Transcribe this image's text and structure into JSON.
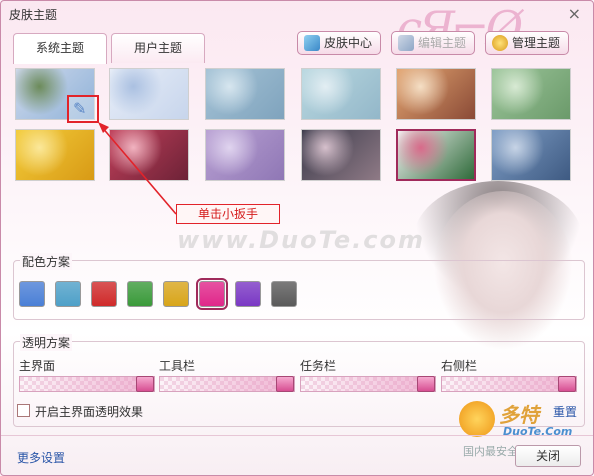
{
  "window": {
    "title": "皮肤主题",
    "close_glyph": "×"
  },
  "tabs": [
    {
      "label": "系统主题",
      "active": true
    },
    {
      "label": "用户主题",
      "active": false
    }
  ],
  "toolbar": {
    "skin_center": "皮肤中心",
    "edit_theme": "编辑主题",
    "manage_theme": "管理主题"
  },
  "themes": [
    {
      "name": "theme-lake",
      "colors": [
        "#cfd9ec",
        "#8fb2d8",
        "#6c8b5a"
      ]
    },
    {
      "name": "theme-light-blue",
      "colors": [
        "#e8eef8",
        "#c7d5ec",
        "#aac0e1"
      ]
    },
    {
      "name": "theme-bokeh-blue",
      "colors": [
        "#a5c3d6",
        "#7fa3bd",
        "#d7e6ef"
      ]
    },
    {
      "name": "theme-teal-haze",
      "colors": [
        "#b9d8e0",
        "#93b7c9",
        "#e3eef3"
      ]
    },
    {
      "name": "theme-swirl",
      "colors": [
        "#e3a571",
        "#8a4a36",
        "#f5dfc5"
      ]
    },
    {
      "name": "theme-bamboo",
      "colors": [
        "#9cc59a",
        "#6b9a6a",
        "#d8ead4"
      ]
    },
    {
      "name": "theme-sunflower",
      "colors": [
        "#f3cc3a",
        "#d89a15",
        "#fbe89a"
      ]
    },
    {
      "name": "theme-red-bokeh",
      "colors": [
        "#c0405a",
        "#6d2237",
        "#f1b3c0"
      ]
    },
    {
      "name": "theme-lilac",
      "colors": [
        "#b9a1d3",
        "#8f77b5",
        "#e0d4ef"
      ]
    },
    {
      "name": "theme-light-streak",
      "colors": [
        "#3a3a4a",
        "#8f7a86",
        "#d6c0cc"
      ]
    },
    {
      "name": "theme-drama",
      "colors": [
        "#f4f4f4",
        "#2f6b3a",
        "#d86a8a"
      ],
      "selected": true
    },
    {
      "name": "theme-city-night",
      "colors": [
        "#7f9ec6",
        "#3e5a82",
        "#c7d4e6"
      ]
    }
  ],
  "callout": "单击小扳手",
  "watermark": "www.DuoTe.com",
  "color_scheme": {
    "label": "配色方案",
    "swatches": [
      {
        "name": "blue",
        "color": "#4a7fd6"
      },
      {
        "name": "teal",
        "color": "#4ea0c8"
      },
      {
        "name": "red",
        "color": "#cf2a2a"
      },
      {
        "name": "green",
        "color": "#3a9a3a"
      },
      {
        "name": "gold",
        "color": "#d8a51a"
      },
      {
        "name": "pink",
        "color": "#e0278a",
        "selected": true
      },
      {
        "name": "purple",
        "color": "#7a38c4"
      },
      {
        "name": "gray",
        "color": "#5a5a5a"
      }
    ]
  },
  "transparency": {
    "label": "透明方案",
    "sliders": [
      {
        "label": "主界面",
        "value": 1.0
      },
      {
        "label": "工具栏",
        "value": 1.0
      },
      {
        "label": "任务栏",
        "value": 1.0
      },
      {
        "label": "右侧栏",
        "value": 1.0
      }
    ],
    "checkbox_label": "开启主界面透明效果",
    "checkbox_checked": false,
    "reset_label": "重置"
  },
  "footer": {
    "more_settings": "更多设置",
    "close": "关闭"
  },
  "corner_logo": {
    "brand": "多特",
    "url": "DuoTe.Com",
    "slogan": "国内最安全的软件站"
  }
}
